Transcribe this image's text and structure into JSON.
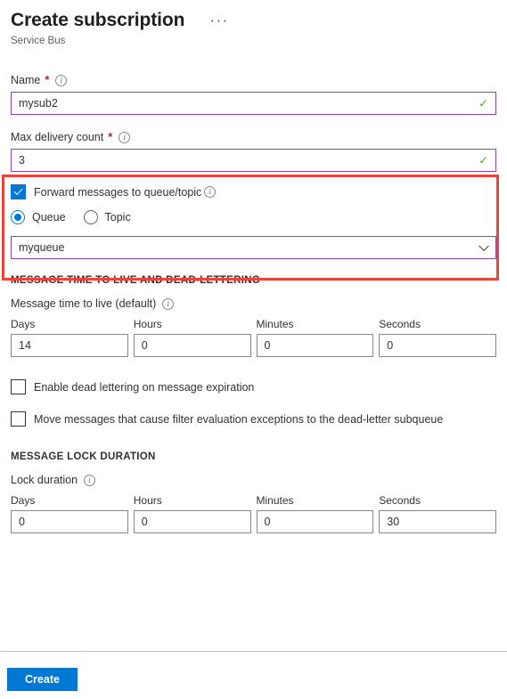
{
  "header": {
    "title": "Create subscription",
    "subtitle": "Service Bus",
    "ellipsis": "···"
  },
  "icons": {
    "info": "i",
    "check": "✓"
  },
  "fields": {
    "name": {
      "label": "Name",
      "required_marker": "*",
      "value": "mysub2"
    },
    "max_delivery_count": {
      "label": "Max delivery count",
      "required_marker": "*",
      "value": "3"
    }
  },
  "forward": {
    "checkbox_label": "Forward messages to queue/topic",
    "checked": true,
    "radio_queue": "Queue",
    "radio_topic": "Topic",
    "selected_radio": "Queue",
    "dropdown_value": "myqueue",
    "highlight_color": "#e8453c"
  },
  "ttl_section": {
    "heading": "MESSAGE TIME TO LIVE AND DEAD-LETTERING",
    "sub_label": "Message time to live (default)",
    "units": [
      "Days",
      "Hours",
      "Minutes",
      "Seconds"
    ],
    "values": [
      "14",
      "0",
      "0",
      "0"
    ],
    "checkbox_dead_lettering": "Enable dead lettering on message expiration",
    "checkbox_dead_lettering_checked": false,
    "checkbox_filter_exceptions": "Move messages that cause filter evaluation exceptions to the dead-letter subqueue",
    "checkbox_filter_exceptions_checked": false
  },
  "lock_section": {
    "heading": "MESSAGE LOCK DURATION",
    "sub_label": "Lock duration",
    "units": [
      "Days",
      "Hours",
      "Minutes",
      "Seconds"
    ],
    "values": [
      "0",
      "0",
      "0",
      "30"
    ]
  },
  "footer": {
    "create_label": "Create"
  },
  "colors": {
    "accent": "#0078d4",
    "valid_border": "#8e44ad",
    "valid_check": "#5ea226",
    "required": "#a4262c"
  }
}
